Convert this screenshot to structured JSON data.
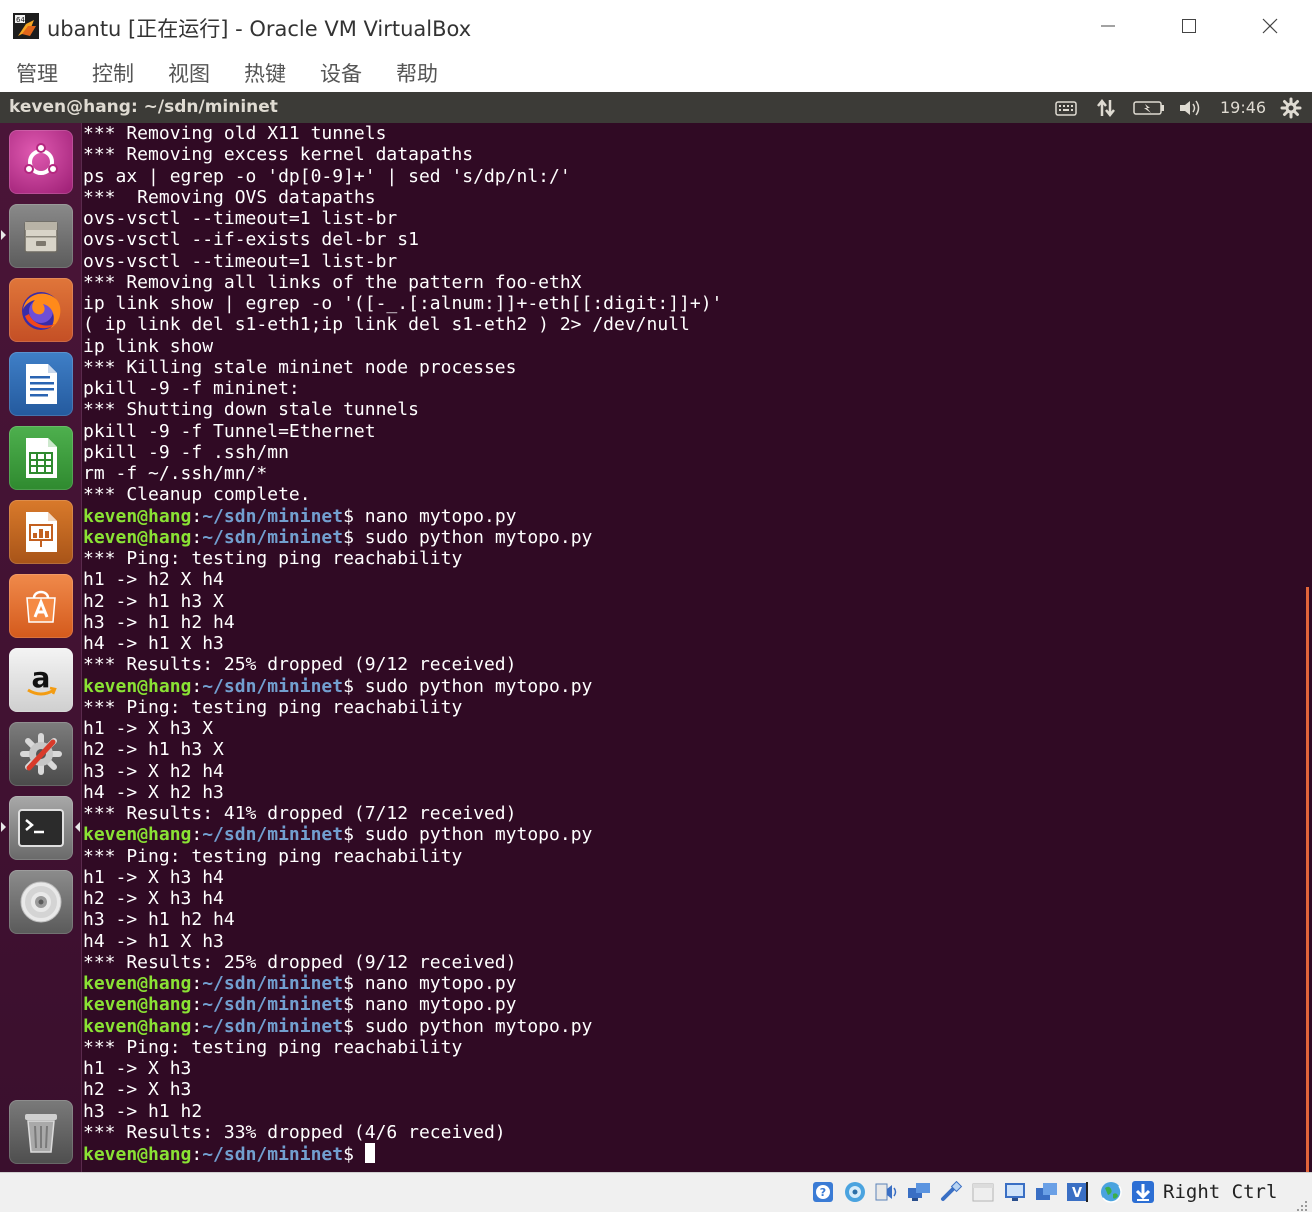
{
  "window": {
    "title": "ubantu [正在运行] - Oracle VM VirtualBox",
    "menu": [
      "管理",
      "控制",
      "视图",
      "热键",
      "设备",
      "帮助"
    ]
  },
  "guest": {
    "topbar_title": "keven@hang: ~/sdn/mininet",
    "clock": "19:46",
    "tray_icons": [
      "keyboard-icon",
      "network-arrows-icon",
      "battery-icon",
      "volume-icon",
      "gear-icon"
    ]
  },
  "launcher": {
    "items": [
      "ubuntu-dash",
      "files",
      "firefox",
      "libreoffice-writer",
      "libreoffice-calc",
      "libreoffice-impress",
      "software-center",
      "amazon",
      "system-settings",
      "terminal",
      "dvd",
      "trash"
    ]
  },
  "colors": {
    "terminal_bg": "#300a24",
    "prompt_user": "#8ae234",
    "prompt_path": "#729fcf",
    "scrollbar": "#e2653a"
  },
  "terminal": {
    "prompt": {
      "user": "keven@hang",
      "sep": ":",
      "path": "~/sdn/mininet",
      "sym": "$"
    },
    "lines": [
      {
        "t": "out",
        "text": "*** Removing old X11 tunnels"
      },
      {
        "t": "out",
        "text": "*** Removing excess kernel datapaths"
      },
      {
        "t": "out",
        "text": "ps ax | egrep -o 'dp[0-9]+' | sed 's/dp/nl:/'"
      },
      {
        "t": "out",
        "text": "***  Removing OVS datapaths"
      },
      {
        "t": "out",
        "text": "ovs-vsctl --timeout=1 list-br"
      },
      {
        "t": "out",
        "text": "ovs-vsctl --if-exists del-br s1"
      },
      {
        "t": "out",
        "text": "ovs-vsctl --timeout=1 list-br"
      },
      {
        "t": "out",
        "text": "*** Removing all links of the pattern foo-ethX"
      },
      {
        "t": "out",
        "text": "ip link show | egrep -o '([-_.[:alnum:]]+-eth[[:digit:]]+)'"
      },
      {
        "t": "out",
        "text": "( ip link del s1-eth1;ip link del s1-eth2 ) 2> /dev/null"
      },
      {
        "t": "out",
        "text": "ip link show"
      },
      {
        "t": "out",
        "text": "*** Killing stale mininet node processes"
      },
      {
        "t": "out",
        "text": "pkill -9 -f mininet:"
      },
      {
        "t": "out",
        "text": "*** Shutting down stale tunnels"
      },
      {
        "t": "out",
        "text": "pkill -9 -f Tunnel=Ethernet"
      },
      {
        "t": "out",
        "text": "pkill -9 -f .ssh/mn"
      },
      {
        "t": "out",
        "text": "rm -f ~/.ssh/mn/*"
      },
      {
        "t": "out",
        "text": "*** Cleanup complete."
      },
      {
        "t": "cmd",
        "text": " nano mytopo.py"
      },
      {
        "t": "cmd",
        "text": " sudo python mytopo.py"
      },
      {
        "t": "out",
        "text": "*** Ping: testing ping reachability"
      },
      {
        "t": "out",
        "text": "h1 -> h2 X h4"
      },
      {
        "t": "out",
        "text": "h2 -> h1 h3 X"
      },
      {
        "t": "out",
        "text": "h3 -> h1 h2 h4"
      },
      {
        "t": "out",
        "text": "h4 -> h1 X h3"
      },
      {
        "t": "out",
        "text": "*** Results: 25% dropped (9/12 received)"
      },
      {
        "t": "cmd",
        "text": " sudo python mytopo.py"
      },
      {
        "t": "out",
        "text": "*** Ping: testing ping reachability"
      },
      {
        "t": "out",
        "text": "h1 -> X h3 X"
      },
      {
        "t": "out",
        "text": "h2 -> h1 h3 X"
      },
      {
        "t": "out",
        "text": "h3 -> X h2 h4"
      },
      {
        "t": "out",
        "text": "h4 -> X h2 h3"
      },
      {
        "t": "out",
        "text": "*** Results: 41% dropped (7/12 received)"
      },
      {
        "t": "cmd",
        "text": " sudo python mytopo.py"
      },
      {
        "t": "out",
        "text": "*** Ping: testing ping reachability"
      },
      {
        "t": "out",
        "text": "h1 -> X h3 h4"
      },
      {
        "t": "out",
        "text": "h2 -> X h3 h4"
      },
      {
        "t": "out",
        "text": "h3 -> h1 h2 h4"
      },
      {
        "t": "out",
        "text": "h4 -> h1 X h3"
      },
      {
        "t": "out",
        "text": "*** Results: 25% dropped (9/12 received)"
      },
      {
        "t": "cmd",
        "text": " nano mytopo.py"
      },
      {
        "t": "cmd",
        "text": " nano mytopo.py"
      },
      {
        "t": "cmd",
        "text": " sudo python mytopo.py"
      },
      {
        "t": "out",
        "text": "*** Ping: testing ping reachability"
      },
      {
        "t": "out",
        "text": "h1 -> X h3"
      },
      {
        "t": "out",
        "text": "h2 -> X h3"
      },
      {
        "t": "out",
        "text": "h3 -> h1 h2"
      },
      {
        "t": "out",
        "text": "*** Results: 33% dropped (4/6 received)"
      },
      {
        "t": "cmd",
        "text": " ",
        "cursor": true
      }
    ]
  },
  "statusbar": {
    "icons": [
      "help-icon",
      "optical-disk-icon",
      "audio-icon",
      "network-icon",
      "usb-icon",
      "shared-folder-icon",
      "display-icon",
      "video-capture-icon",
      "vbox-icon",
      "mouse-integration-icon",
      "globe-icon",
      "download-arrow-icon"
    ],
    "host_key": "Right Ctrl"
  }
}
